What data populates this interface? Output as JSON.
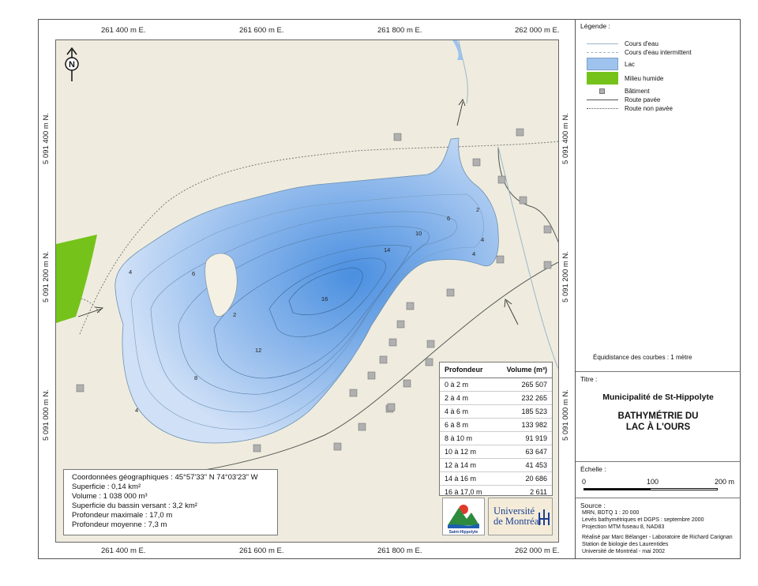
{
  "coords": {
    "top": [
      "261 400 m E.",
      "261 600 m E.",
      "261 800 m E.",
      "262 000 m E."
    ],
    "bottom": [
      "261 400 m E.",
      "261 600 m E.",
      "261 800 m E.",
      "262 000 m E."
    ],
    "left": [
      "5 091 400 m N.",
      "5 091 200 m N.",
      "5 091 000 m N."
    ],
    "right": [
      "5 091 400 m N.",
      "5 091 200 m N.",
      "5 091 000 m N."
    ]
  },
  "north_label": "N",
  "contour_labels": [
    "2",
    "4",
    "6",
    "8",
    "10",
    "12",
    "14",
    "16",
    "2",
    "4",
    "4",
    "4",
    "6",
    "2",
    "6"
  ],
  "legend": {
    "title": "Légende :",
    "items": [
      {
        "label": "Cours d'eau",
        "kind": "line-light"
      },
      {
        "label": "Cours d'eau intermittent",
        "kind": "line-dash"
      },
      {
        "label": "Lac",
        "kind": "fill-lake"
      },
      {
        "label": "Milieu humide",
        "kind": "fill-wet"
      },
      {
        "label": "Bâtiment",
        "kind": "building"
      },
      {
        "label": "Route pavée",
        "kind": "line-dark"
      },
      {
        "label": "Route non pavée",
        "kind": "line-dot"
      }
    ],
    "equidistance": "Équidistance des courbes : 1 mètre"
  },
  "colors": {
    "lake": "#9ec3ee",
    "lake_deep": "#3f86dc",
    "wetland": "#75c31a",
    "land": "#efecdf"
  },
  "title_section": {
    "label": "Titre :",
    "municipality": "Municipalité de St-Hippolyte",
    "title_line1": "BATHYMÉTRIE DU",
    "title_line2": "LAC À L'OURS"
  },
  "scale": {
    "label": "Échelle :",
    "ticks": [
      "0",
      "100",
      "200 m"
    ]
  },
  "source": {
    "label": "Source :",
    "lines": [
      "MRN, BDTQ 1 : 20 000",
      "Levés bathymétriques et DGPS : septembre 2000",
      "Projection MTM fuseau 8, NAD83"
    ],
    "credits": [
      "Réalisé par Marc Bélanger - Laboratoire de Richard Carignan",
      "Station de biologie des Laurentides",
      "Université de Montréal - mai 2002"
    ]
  },
  "info": [
    "Coordonnées géographiques : 45°57'33\" N  74°03'23\" W",
    "Superficie : 0,14 km²",
    "Volume :  1 038 000 m³",
    "Superficie du bassin versant : 3,2 km²",
    "Profondeur maximale : 17,0 m",
    "Profondeur moyenne : 7,3 m"
  ],
  "volume_table": {
    "headers": [
      "Profondeur",
      "Volume (m³)"
    ],
    "rows": [
      [
        "0 à 2 m",
        "265 507"
      ],
      [
        "2 à 4 m",
        "232 265"
      ],
      [
        "4 à 6 m",
        "185 523"
      ],
      [
        "6 à 8 m",
        "133 982"
      ],
      [
        "8 à 10 m",
        "91 919"
      ],
      [
        "10 à 12 m",
        "63 647"
      ],
      [
        "12 à 14 m",
        "41 453"
      ],
      [
        "14 à 16 m",
        "20 686"
      ],
      [
        "16 à 17,0 m",
        "2 611"
      ]
    ]
  },
  "logos": {
    "municipal": "Saint-Hippolyte",
    "university_line1": "Université",
    "university_line2": "de Montréal"
  }
}
